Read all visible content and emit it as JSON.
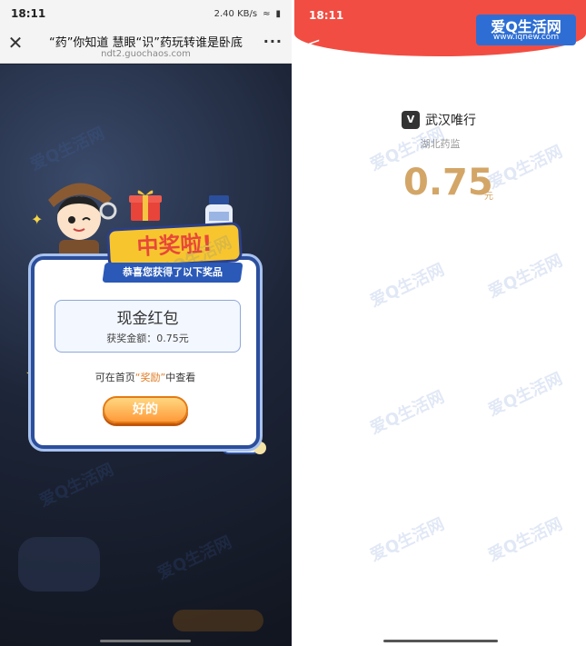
{
  "left_screen": {
    "status_time": "18:11",
    "status_net": "2.40 KB/s",
    "nav_title": "“药”你知道 慧眼“识”药玩转谁是卧底",
    "nav_url": "ndt2.guochaos.com",
    "banner": "中奖啦!",
    "ribbon": "恭喜您获得了以下奖品",
    "prize_name": "现金红包",
    "prize_amount": "获奖金额：0.75元",
    "hint_prefix": "可在首页",
    "hint_highlight": "“奖励”",
    "hint_suffix": "中查看",
    "ok_button": "好的"
  },
  "right_screen": {
    "status_time": "18:11",
    "merchant_icon": "V",
    "merchant_name": "武汉唯行",
    "sub_name": "湖北药监",
    "amount": "0.75",
    "unit": "元"
  },
  "watermark": {
    "logo_text": "爱Q生活网",
    "logo_url": "www.iqnew.com"
  },
  "colors": {
    "accent_red": "#f24d42",
    "amount_gold": "#d3a667",
    "card_blue": "#2c4f9c",
    "button_orange": "#ff9a3a"
  },
  "icons": {
    "close": "close-icon",
    "more": "more-icon",
    "back": "back-arrow-icon"
  }
}
